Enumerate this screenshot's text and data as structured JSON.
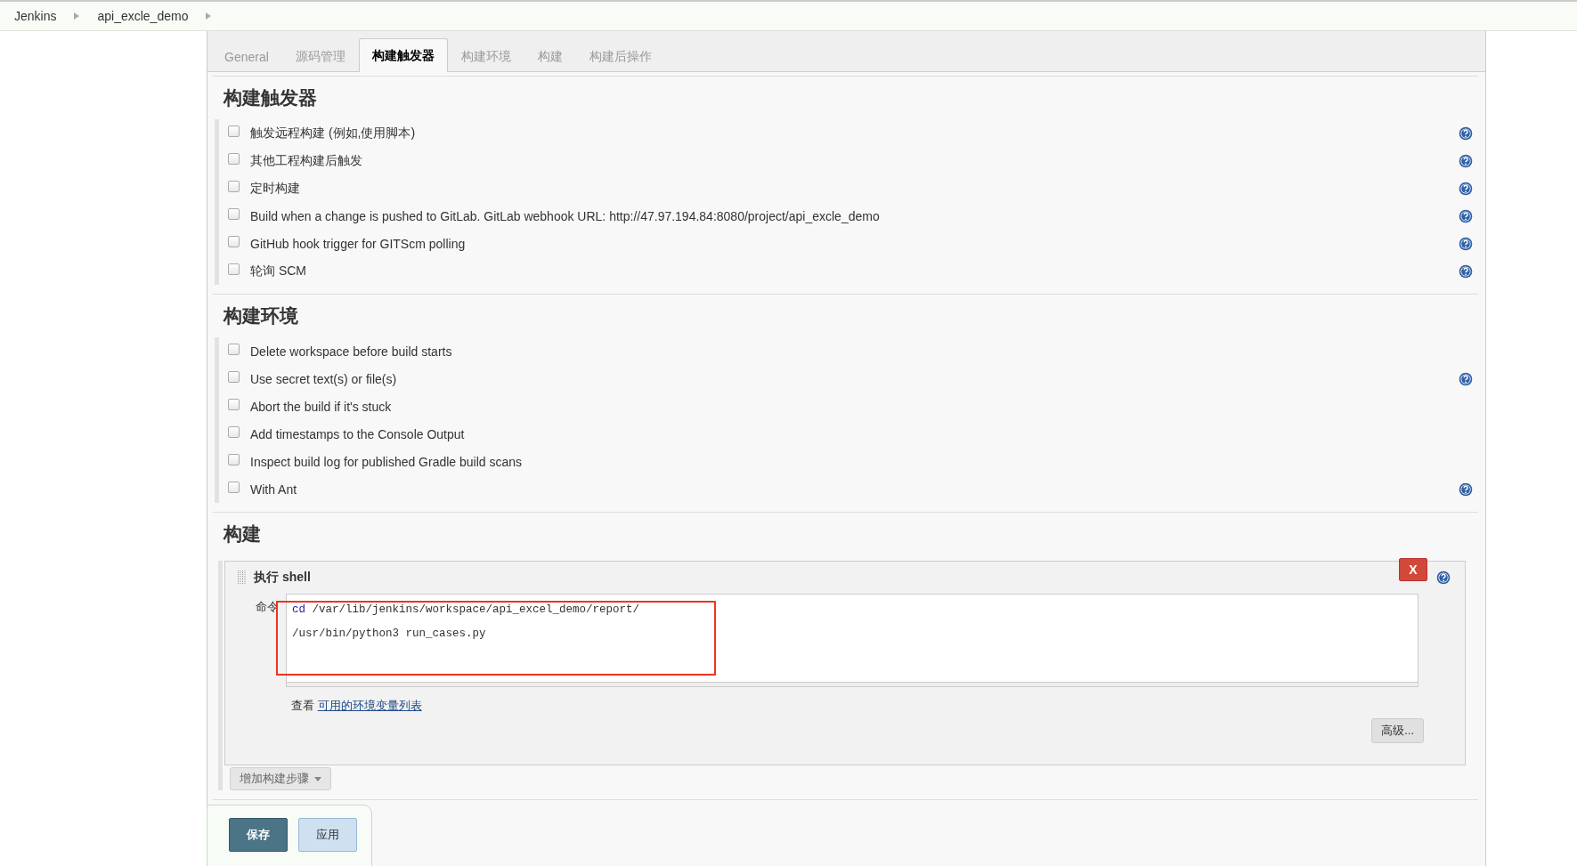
{
  "breadcrumbs": [
    "Jenkins",
    "api_excle_demo"
  ],
  "tabs": [
    {
      "label": "General",
      "selected": false
    },
    {
      "label": "源码管理",
      "selected": false
    },
    {
      "label": "构建触发器",
      "selected": true
    },
    {
      "label": "构建环境",
      "selected": false
    },
    {
      "label": "构建",
      "selected": false
    },
    {
      "label": "构建后操作",
      "selected": false
    }
  ],
  "sections": [
    {
      "kind": "options",
      "title": "构建触发器",
      "options": [
        {
          "label": "触发远程构建 (例如,使用脚本)",
          "checked": false,
          "help": true
        },
        {
          "label": "其他工程构建后触发",
          "checked": false,
          "help": true
        },
        {
          "label": "定时构建",
          "checked": false,
          "help": true
        },
        {
          "label": "Build when a change is pushed to GitLab. GitLab webhook URL: http://47.97.194.84:8080/project/api_excle_demo",
          "checked": false,
          "help": true
        },
        {
          "label": "GitHub hook trigger for GITScm polling",
          "checked": false,
          "help": true
        },
        {
          "label": "轮询 SCM",
          "checked": false,
          "help": true
        }
      ]
    },
    {
      "kind": "options",
      "title": "构建环境",
      "options": [
        {
          "label": "Delete workspace before build starts",
          "checked": false,
          "help": false
        },
        {
          "label": "Use secret text(s) or file(s)",
          "checked": false,
          "help": true
        },
        {
          "label": "Abort the build if it's stuck",
          "checked": false,
          "help": false
        },
        {
          "label": "Add timestamps to the Console Output",
          "checked": false,
          "help": false
        },
        {
          "label": "Inspect build log for published Gradle build scans",
          "checked": false,
          "help": false
        },
        {
          "label": "With Ant",
          "checked": false,
          "help": true
        }
      ]
    },
    {
      "kind": "build",
      "title": "构建",
      "step": {
        "title": "执行 shell",
        "delete": "X",
        "field_label": "命令",
        "code": [
          {
            "keyword": "cd",
            "rest": " /var/lib/jenkins/workspace/api_excel_demo/report/"
          },
          {
            "rest": "/usr/bin/python3 run_cases.py"
          }
        ],
        "hint": "查看",
        "hint_link": "可用的环境变量列表",
        "advanced": "高级..."
      },
      "add_step": "增加构建步骤"
    }
  ],
  "save_bar": {
    "save": "保存",
    "apply": "应用"
  }
}
